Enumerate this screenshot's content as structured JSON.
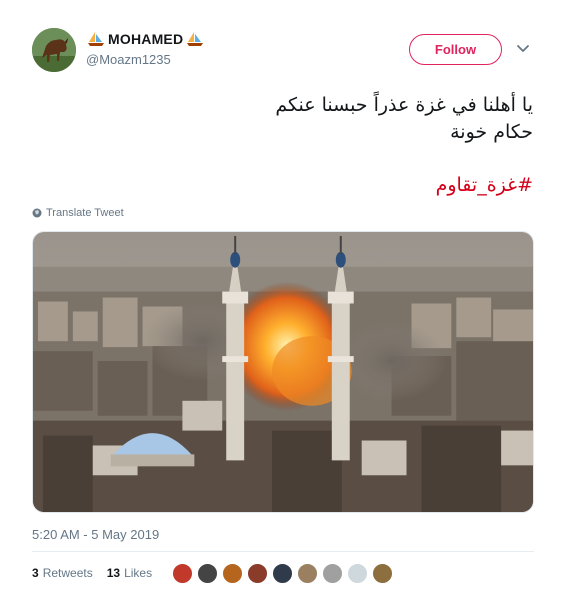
{
  "author": {
    "display_name": "MOHAMED",
    "handle": "@Moazm1235",
    "name_emoji_left": "sailboat-icon",
    "name_emoji_right": "sailboat-icon"
  },
  "follow_button": {
    "label": "Follow",
    "color": "#e0245e"
  },
  "tweet": {
    "text_line1": "يا أهلنا في غزة عذراً حبسنا عنكم",
    "text_line2": "حكام خونة",
    "hashtag": "#غزة_تقاوم",
    "hashtag_color": "#d4001a",
    "translate_label": "Translate Tweet"
  },
  "timestamp": "5:20 AM - 5 May 2019",
  "stats": {
    "retweets_count": "3",
    "retweets_label": "Retweets",
    "likes_count": "13",
    "likes_label": "Likes"
  },
  "likers": [
    {
      "name": "liker-avatar",
      "color": "#c0392b"
    },
    {
      "name": "liker-avatar",
      "color": "#444444"
    },
    {
      "name": "liker-avatar",
      "color": "#b5651d"
    },
    {
      "name": "liker-avatar",
      "color": "#8a3b2a"
    },
    {
      "name": "liker-avatar",
      "color": "#2f3a4a"
    },
    {
      "name": "liker-avatar",
      "color": "#9a8060"
    },
    {
      "name": "liker-avatar",
      "color": "#a0a0a0"
    },
    {
      "name": "liker-avatar",
      "color": "#cfd8dc"
    },
    {
      "name": "liker-avatar",
      "color": "#8d6e3f"
    }
  ]
}
